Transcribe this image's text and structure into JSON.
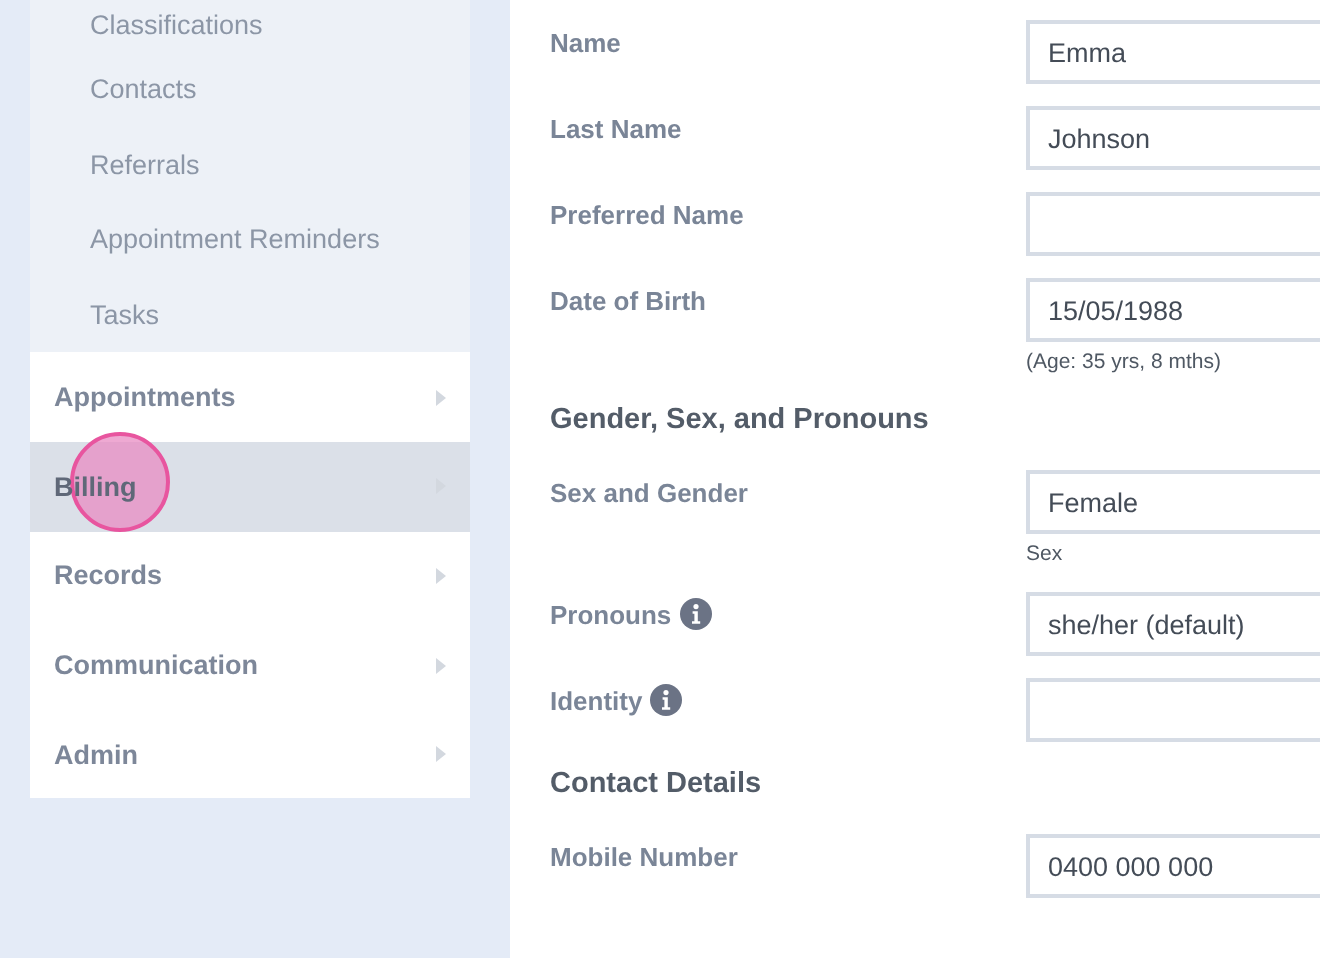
{
  "sidebar": {
    "sub_items": [
      {
        "label": "Classifications"
      },
      {
        "label": "Contacts"
      },
      {
        "label": "Referrals"
      },
      {
        "label": "Appointment Reminders"
      },
      {
        "label": "Tasks"
      }
    ],
    "items": [
      {
        "label": "Appointments",
        "selected": false,
        "click_highlight": false
      },
      {
        "label": "Billing",
        "selected": true,
        "click_highlight": true
      },
      {
        "label": "Records",
        "selected": false,
        "click_highlight": false
      },
      {
        "label": "Communication",
        "selected": false,
        "click_highlight": false
      },
      {
        "label": "Admin",
        "selected": false,
        "click_highlight": false
      }
    ]
  },
  "form": {
    "rows": [
      {
        "kind": "field",
        "label": "Name",
        "value": "Emma"
      },
      {
        "kind": "field",
        "label": "Last Name",
        "value": "Johnson"
      },
      {
        "kind": "field",
        "label": "Preferred Name"
      },
      {
        "kind": "field",
        "label": "Date of Birth",
        "value": "15/05/1988",
        "hint": "(Age: 35 yrs, 8 mths)"
      },
      {
        "kind": "heading",
        "label": "Gender, Sex, and Pronouns"
      },
      {
        "kind": "field",
        "label": "Sex and Gender",
        "value": "Female",
        "hint": "Sex"
      },
      {
        "kind": "field",
        "label": "Pronouns",
        "value": "she/her (default)",
        "info": true
      },
      {
        "kind": "field",
        "label": "Identity",
        "info": true
      },
      {
        "kind": "heading",
        "label": "Contact Details"
      },
      {
        "kind": "field",
        "label": "Mobile Number",
        "value": "0400 000 000"
      }
    ]
  }
}
